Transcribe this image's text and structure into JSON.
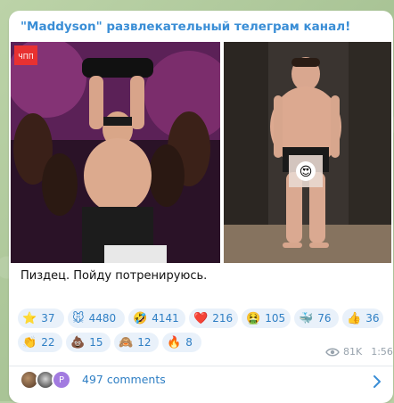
{
  "post": {
    "channel_title": "\"Maddyson\" развлекательный телеграм канал!",
    "caption": "Пиздец. Пойду потренируюсь.",
    "views": "81K",
    "time": "1:56",
    "comments_label": "497 comments",
    "avatar_letter": "P"
  },
  "photos": {
    "left_badge": "ЧПП",
    "face_reaction": "😍"
  },
  "reactions": [
    {
      "emoji": "⭐",
      "icon": "star-icon",
      "count": "37"
    },
    {
      "emoji": "🐭",
      "icon": "hamster-icon",
      "count": "4480"
    },
    {
      "emoji": "🤣",
      "icon": "rofl-icon",
      "count": "4141"
    },
    {
      "emoji": "❤️",
      "icon": "heart-icon",
      "count": "216"
    },
    {
      "emoji": "🤮",
      "icon": "vomit-icon",
      "count": "105"
    },
    {
      "emoji": "🐳",
      "icon": "whale-icon",
      "count": "76"
    },
    {
      "emoji": "👍",
      "icon": "thumbs-up-icon",
      "count": "36"
    },
    {
      "emoji": "👏",
      "icon": "clap-icon",
      "count": "22"
    },
    {
      "emoji": "💩",
      "icon": "poop-icon",
      "count": "15"
    },
    {
      "emoji": "🙈",
      "icon": "monkey-icon",
      "count": "12"
    },
    {
      "emoji": "🔥",
      "icon": "fire-icon",
      "count": "8"
    }
  ],
  "colors": {
    "accent": "#3a8ed6",
    "reaction_bg": "#e9f1fa",
    "reaction_text": "#2f7fc4"
  }
}
